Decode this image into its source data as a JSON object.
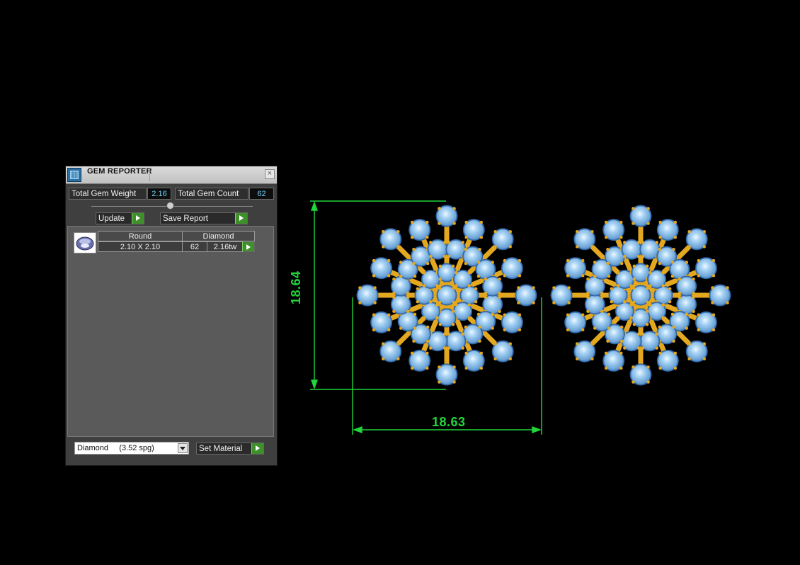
{
  "panel": {
    "title": "GEM REPORTER",
    "close_label": "×",
    "total_gem_weight_label": "Total Gem Weight",
    "total_gem_weight_value": "2.16",
    "total_gem_count_label": "Total Gem Count",
    "total_gem_count_value": "62",
    "update_label": "Update",
    "save_report_label": "Save Report",
    "row": {
      "shape": "Round",
      "material": "Diamond",
      "size": "2.10 X 2.10",
      "count": "62",
      "weight": "2.16tw"
    },
    "material_select": {
      "value": "Diamond     (3.52 spg)"
    },
    "set_material_label": "Set Material"
  },
  "drawing": {
    "height_dimension": "18.64",
    "width_dimension": "18.63",
    "colors": {
      "dimension": "#21d63a",
      "gem": "#8ec3f0",
      "metal": "#e4a820"
    }
  }
}
